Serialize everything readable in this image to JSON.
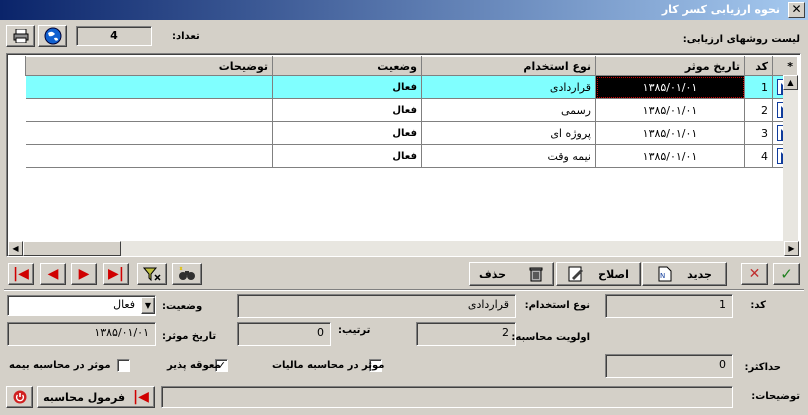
{
  "window": {
    "title": "نحوه ارزیابی کسر کار"
  },
  "header": {
    "count_label": "تعداد:",
    "count_value": "4",
    "list_label": "لیست روشهای ارزیابی:"
  },
  "grid": {
    "columns": [
      "*",
      "کد",
      "تاریخ موثر",
      "نوع استخدام",
      "وضعیت",
      "توضیحات"
    ],
    "rows": [
      {
        "code": "1",
        "date": "۱۳۸۵/۰۱/۰۱",
        "type": "قراردادی",
        "status": "فعال",
        "notes": ""
      },
      {
        "code": "2",
        "date": "۱۳۸۵/۰۱/۰۱",
        "type": "رسمی",
        "status": "فعال",
        "notes": ""
      },
      {
        "code": "3",
        "date": "۱۳۸۵/۰۱/۰۱",
        "type": "پروژه ای",
        "status": "فعال",
        "notes": ""
      },
      {
        "code": "4",
        "date": "۱۳۸۵/۰۱/۰۱",
        "type": "نیمه وقت",
        "status": "فعال",
        "notes": ""
      }
    ]
  },
  "toolbar": {
    "new_label": "جدید",
    "edit_label": "اصلاح",
    "delete_label": "حذف"
  },
  "form": {
    "code_label": "کد:",
    "code_value": "1",
    "employment_label": "نوع استخدام:",
    "employment_value": "قراردادی",
    "status_label": "وضعیت:",
    "status_value": "فعال",
    "priority_label": "اولویت محاسبه:",
    "priority_value": "2",
    "order_label": "ترتیب:",
    "order_value": "0",
    "date_label": "تاریخ موثر:",
    "date_value": "۱۳۸۵/۰۱/۰۱",
    "max_label": "حداکثر:",
    "max_value": "0",
    "tax_label": "موثر در محاسبه مالیات",
    "tax_checked": false,
    "offset_label": "معوقه پذیر",
    "offset_checked": true,
    "insurance_label": "موثر در محاسبه بیمه",
    "insurance_checked": false,
    "notes_label": "توضیحات:",
    "notes_value": "",
    "formula_label": "فرمول محاسبه"
  },
  "colors": {
    "selected_row": "#80ffff",
    "title_gradient_start": "#0a246a",
    "title_gradient_end": "#a6caf0"
  }
}
